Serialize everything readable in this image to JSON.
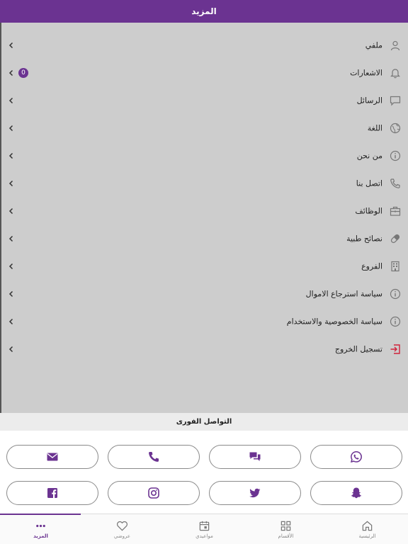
{
  "header": {
    "title": "المزيد"
  },
  "menu": [
    {
      "label": "ملفي",
      "icon": "user-icon"
    },
    {
      "label": "الاشعارات",
      "icon": "bell-icon",
      "badge": "0"
    },
    {
      "label": "الرسائل",
      "icon": "message-icon"
    },
    {
      "label": "اللغة",
      "icon": "globe-icon"
    },
    {
      "label": "من نحن",
      "icon": "info-icon"
    },
    {
      "label": "اتصل بنا",
      "icon": "phone-icon"
    },
    {
      "label": "الوظائف",
      "icon": "briefcase-icon"
    },
    {
      "label": "نصائح طبية",
      "icon": "pill-icon"
    },
    {
      "label": "الفروع",
      "icon": "building-icon"
    },
    {
      "label": "سياسة استرجاع الاموال",
      "icon": "info-icon"
    },
    {
      "label": "سياسة الخصوصية والاستخدام",
      "icon": "info-icon"
    },
    {
      "label": "تسجيل الخروج",
      "icon": "logout-icon"
    }
  ],
  "quick_contact": {
    "title": "التواصل الفورى",
    "buttons": [
      "whatsapp-icon",
      "chat-icon",
      "phone-icon",
      "mail-icon",
      "snapchat-icon",
      "twitter-icon",
      "instagram-icon",
      "facebook-icon"
    ]
  },
  "tabs": [
    {
      "label": "الرئيسية",
      "icon": "home-icon"
    },
    {
      "label": "الأقسام",
      "icon": "grid-icon"
    },
    {
      "label": "مواعيدي",
      "icon": "calendar-icon"
    },
    {
      "label": "عروضي",
      "icon": "heart-icon"
    },
    {
      "label": "المزيد",
      "icon": "more-icon",
      "active": true
    }
  ],
  "colors": {
    "accent": "#6b3391",
    "menu_bg": "#cdcdcd",
    "logout_red": "#d0213a"
  }
}
